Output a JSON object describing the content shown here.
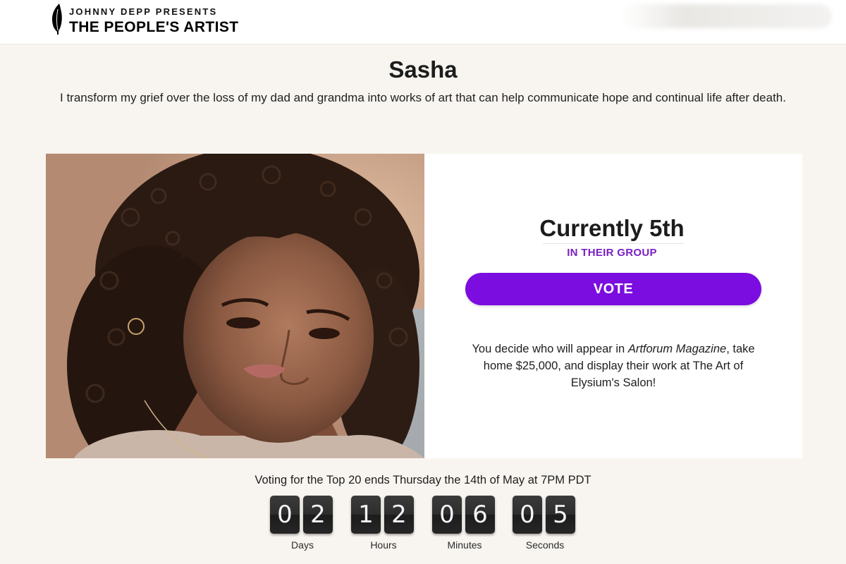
{
  "header": {
    "logo_presenter": "JOHNNY DEPP PRESENTS",
    "logo_title": "THE PEOPLE'S ARTIST",
    "logo_icon": "quill-icon"
  },
  "artist": {
    "name": "Sasha",
    "bio": "I transform my grief over the loss of my dad and grandma into works of art that can help communicate hope and continual life after death."
  },
  "ranking": {
    "title": "Currently 5th",
    "subtitle": "IN THEIR GROUP"
  },
  "vote_button": {
    "label": "VOTE"
  },
  "prize": {
    "text_before": "You decide who will appear in ",
    "magazine": "Artforum Magazine",
    "text_after": ", take home $25,000, and display their work at The Art of Elysium's Salon!"
  },
  "countdown": {
    "deadline": "Voting for the Top 20 ends Thursday the 14th of May at 7PM PDT",
    "days": {
      "d1": "0",
      "d2": "2",
      "label": "Days"
    },
    "hours": {
      "d1": "1",
      "d2": "2",
      "label": "Hours"
    },
    "minutes": {
      "d1": "0",
      "d2": "6",
      "label": "Minutes"
    },
    "seconds": {
      "d1": "0",
      "d2": "5",
      "label": "Seconds"
    }
  },
  "colors": {
    "accent": "#7b0de0",
    "accent_text": "#7a1fc2",
    "page_bg": "#f8f5f0",
    "digit_bg": "#2e2e2e"
  }
}
